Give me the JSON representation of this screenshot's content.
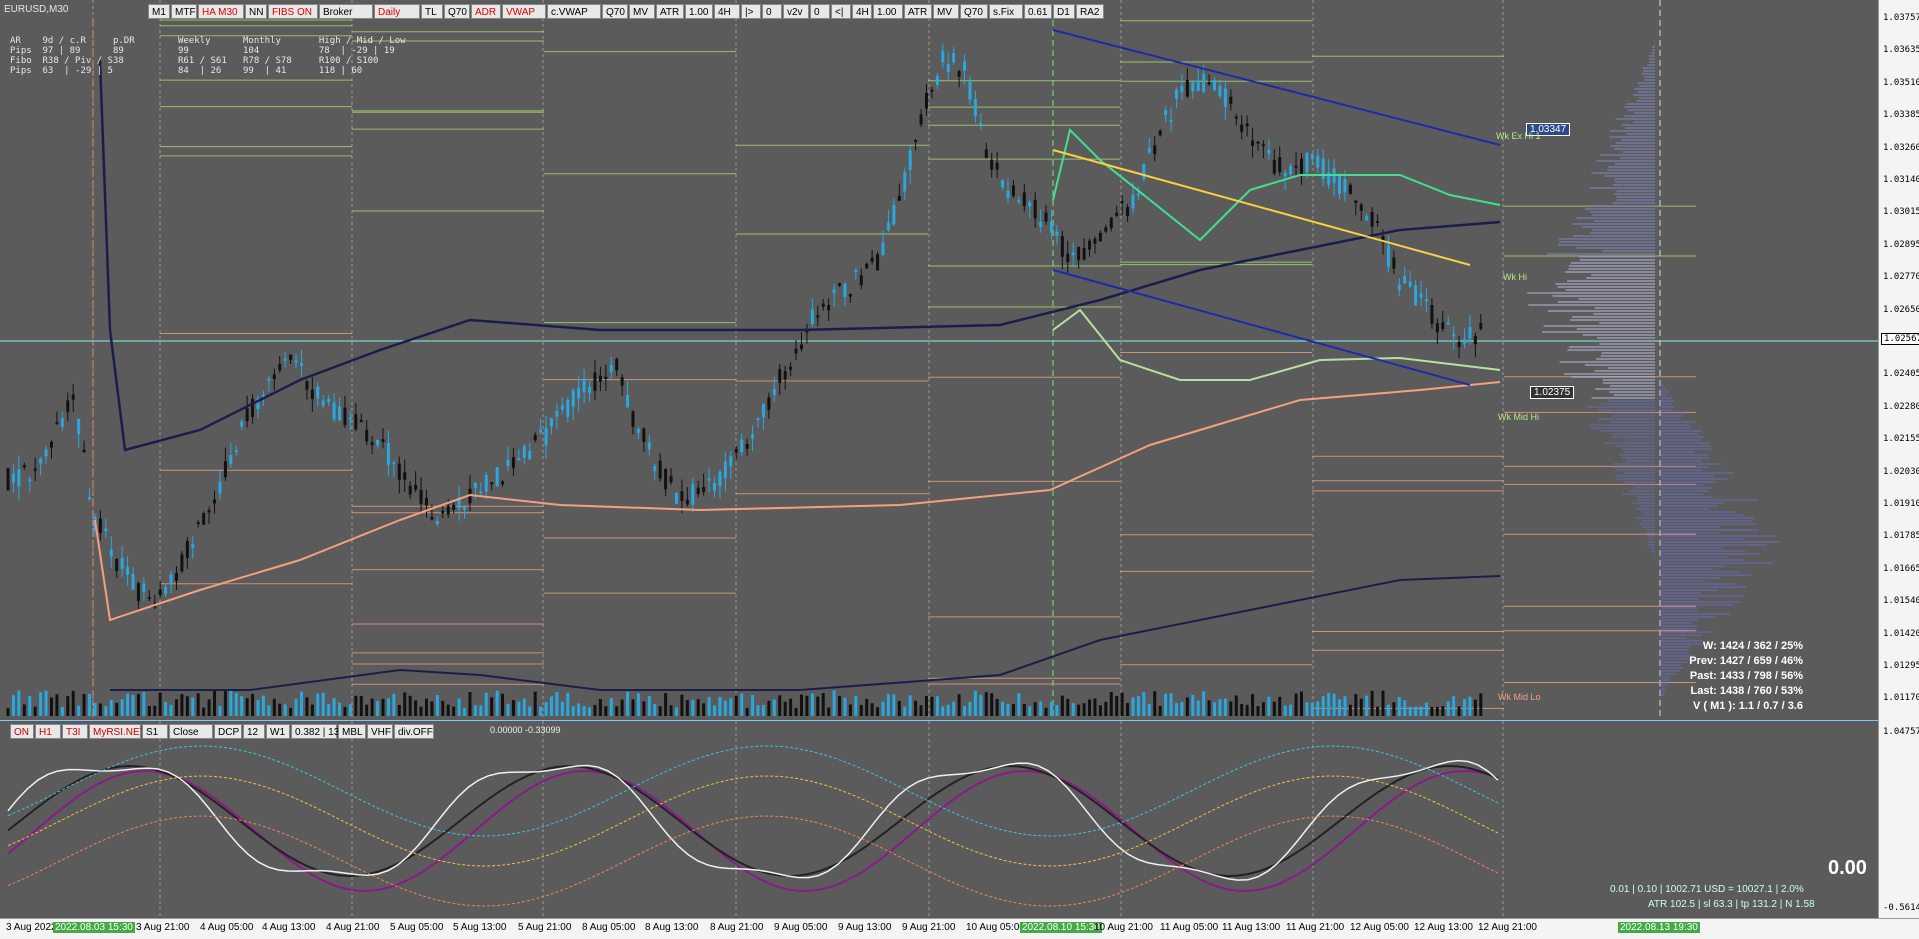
{
  "symbol": "EURUSD,M30",
  "toolbar_main": [
    "M1",
    "MTF",
    "HA M30",
    "NN",
    "FIBS ON",
    "Broker",
    "Daily",
    "TL",
    "Q70",
    "ADR",
    "VWAP",
    "c.VWAP",
    "Q70",
    "MV",
    "ATR",
    "1.00",
    "4H",
    "|>",
    "0",
    "v2v",
    "0",
    "<|",
    "4H",
    "1.00",
    "ATR",
    "MV",
    "Q70",
    "s.Fix",
    "0.61",
    "D1",
    "RA2"
  ],
  "toolbar_sub": [
    "ON",
    "H1",
    "T3I",
    "MyRSI.NET",
    "S1",
    "Close",
    "DCP",
    "12",
    "W1",
    "0.382 | 13",
    "MBL",
    "VHF",
    "div.OFF"
  ],
  "sub_values": "0.00000 -0.33099",
  "info_lines": [
    "AR    9d / c.R     p.DR        Weekly      Monthly       High / Mid / Low",
    "Pips  97 | 89      89          99          104           78  | -29 | 19",
    "Fibo  R38 / Piv / S38          R61 / S61   R78 / S78     R100 / S100",
    "Pips  63  | -29 | 5            84  | 26    99  | 41      118 | 60"
  ],
  "stats_lines": [
    "W: 1424 / 362 / 25%",
    "Prev: 1427 / 659 / 46%",
    "Past: 1433 / 798 / 56%",
    "Last: 1438 / 760 / 53%",
    "V ( M1 ): 1.1 / 0.7 / 3.6"
  ],
  "bottom_value": "0.00",
  "bottom_line1": "0.01  |  0.10  |  1002.71 USD = 10027.1  |  2.0%",
  "bottom_line2": "ATR 102.5  | sl 63.3  | tp 131.2  | N 1.58",
  "price_boxes": [
    "1.03347",
    "1.02375"
  ],
  "right_labels": [
    "Wk Ex Hi 1",
    "Wk Hi",
    "Wk Mid Hi",
    "Wk Mid Lo"
  ],
  "y_ticks": [
    "1.03757",
    "1.03635",
    "1.03510",
    "1.03385",
    "1.03260",
    "1.03140",
    "1.03015",
    "1.02895",
    "1.02770",
    "1.02650",
    "1.02525",
    "1.02405",
    "1.02280",
    "1.02155",
    "1.02030",
    "1.01910",
    "1.01785",
    "1.01665",
    "1.01540",
    "1.01420",
    "1.01295",
    "1.01170"
  ],
  "current_price": "1.02567",
  "sub_y_ticks": [
    "1.04757",
    "-0.56142"
  ],
  "x_ticks": [
    "3 Aug 2022",
    "2022.08.03 15:30",
    "3 Aug 21:00",
    "4 Aug 05:00",
    "4 Aug 13:00",
    "4 Aug 21:00",
    "5 Aug 05:00",
    "5 Aug 13:00",
    "5 Aug 21:00",
    "8 Aug 05:00",
    "8 Aug 13:00",
    "8 Aug 21:00",
    "9 Aug 05:00",
    "9 Aug 13:00",
    "9 Aug 21:00",
    "10 Aug 05:00",
    "2022.08.10 15:30",
    "10 Aug 21:00",
    "11 Aug 05:00",
    "11 Aug 13:00",
    "11 Aug 21:00",
    "12 Aug 05:00",
    "12 Aug 13:00",
    "12 Aug 21:00",
    "2022.08.13 19:30"
  ],
  "colors": {
    "up": "#29a8e0",
    "down": "#111111",
    "background": "#5b5b5b"
  }
}
